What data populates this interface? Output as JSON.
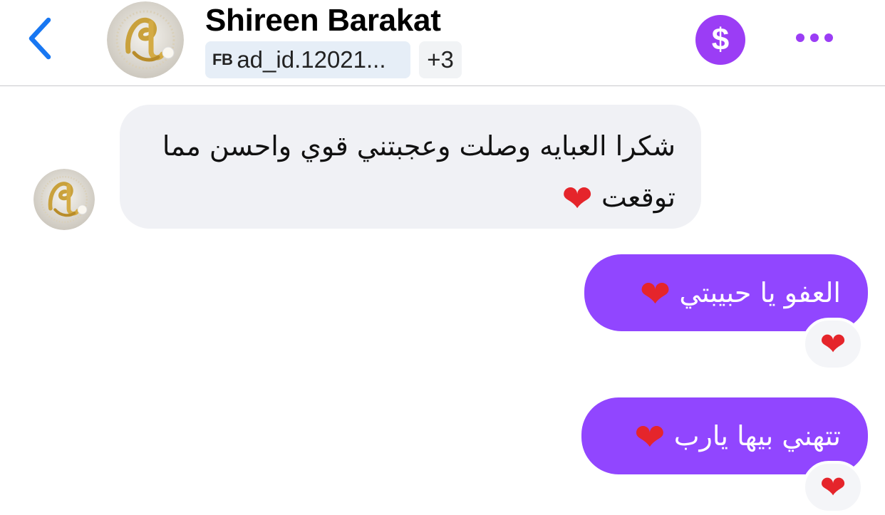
{
  "header": {
    "contact_name": "Shireen Barakat",
    "tag_source": "FB",
    "tag_label": "ad_id.12021...",
    "more_tags": "+3",
    "payment_symbol": "$"
  },
  "messages": [
    {
      "direction": "incoming",
      "text": "شكرا العبايه وصلت وعجبتني قوي واحسن مما توقعت",
      "emoji": "❤"
    },
    {
      "direction": "outgoing",
      "text": "العفو يا حبيبتي",
      "emoji": "❤",
      "reaction": "❤"
    },
    {
      "direction": "outgoing",
      "text": "تتهني بيها يارب",
      "emoji": "❤",
      "reaction": "❤"
    }
  ],
  "colors": {
    "accent": "#9146ff",
    "payment": "#9b3df5",
    "back_arrow": "#1877f2",
    "incoming_bubble": "#f0f1f5",
    "heart": "#e5252b"
  },
  "icons": {
    "back": "chevron-left-icon",
    "payment": "dollar-icon",
    "more": "more-horizontal-icon",
    "avatar": "gold-calligraphy-avatar"
  }
}
